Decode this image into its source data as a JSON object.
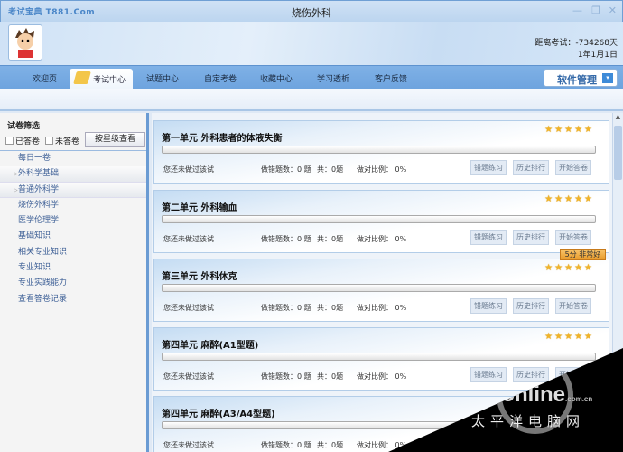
{
  "window": {
    "logo": "考试宝典 T881.Com",
    "title": "烧伤外科",
    "minimize": "—",
    "restore": "❐",
    "close": "✕"
  },
  "header": {
    "exam_countdown": "距离考试：-734268天",
    "exam_date": "1年1月1日"
  },
  "nav": {
    "tabs": [
      "欢迎页",
      "考试中心",
      "试题中心",
      "自定考卷",
      "收藏中心",
      "学习透析",
      "客户反馈"
    ],
    "active": 1,
    "software_manage": "软件管理",
    "dropdown": "▾"
  },
  "sidebar": {
    "filter_title": "试卷筛选",
    "answered": "已答卷",
    "unanswered": "未答卷",
    "by_star": "按星级查看",
    "items": [
      "每日一卷",
      "外科学基础",
      "普通外科学",
      "烧伤外科学",
      "医学伦理学",
      "基础知识",
      "相关专业知识",
      "专业知识",
      "专业实践能力",
      "查看答卷记录"
    ]
  },
  "cards": [
    {
      "title": "第一单元  外科患者的体液失衡",
      "status": "您还未做过该试",
      "wrong": "做错题数：0 题",
      "total": "共：0题",
      "ratio": "做对比例： 0%",
      "progress": 0,
      "stars": 5
    },
    {
      "title": "第二单元  外科输血",
      "status": "您还未做过该试",
      "wrong": "做错题数：0 题",
      "total": "共：0题",
      "ratio": "做对比例： 0%",
      "progress": 0,
      "stars": 5
    },
    {
      "title": "第三单元  外科休克",
      "status": "您还未做过该试",
      "wrong": "做错题数：0 题",
      "total": "共：0题",
      "ratio": "做对比例： 0%",
      "progress": 0,
      "stars": 5
    },
    {
      "title": "第四单元  麻醉(A1型题)",
      "status": "您还未做过该试",
      "wrong": "做错题数：0 题",
      "total": "共：0题",
      "ratio": "做对比例： 0%",
      "progress": 0,
      "stars": 5
    },
    {
      "title": "第四单元  麻醉(A3/A4型题)",
      "status": "您还未做过该试",
      "wrong": "做错题数：0 题",
      "total": "共：0题",
      "ratio": "做对比例： 0%",
      "progress": 0,
      "stars": 5
    }
  ],
  "card_buttons": {
    "wrong_practice": "错题练习",
    "history_rank": "历史排行",
    "start": "开始答卷"
  },
  "tooltip": "5分 非常好",
  "watermark": {
    "brand": "PConline",
    "domain": ".com.cn",
    "cn": "太平洋电脑网"
  },
  "colors": {
    "nav": "#7fb1e6",
    "star": "#f0b429",
    "tooltip": "#f0a840"
  }
}
